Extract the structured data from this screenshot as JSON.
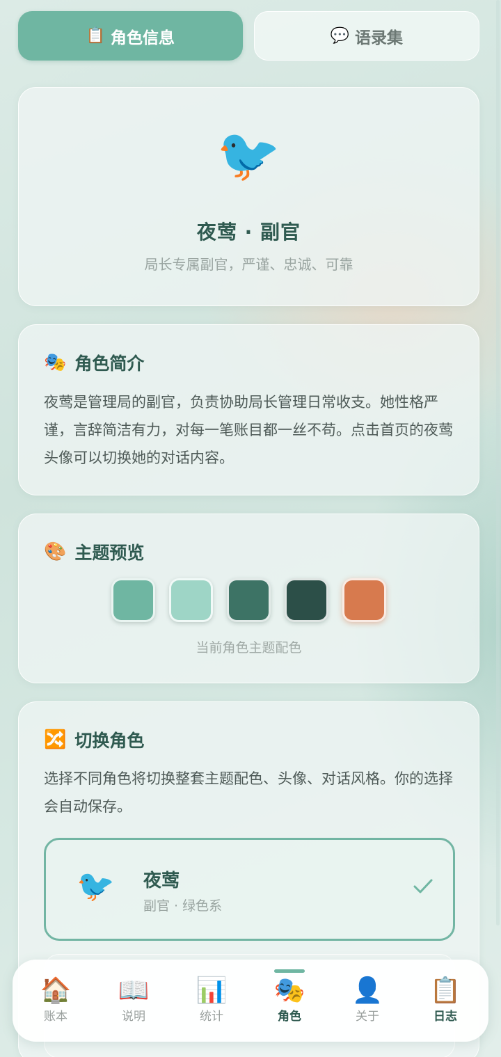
{
  "tabs": [
    {
      "label": "角色信息",
      "icon": "📋",
      "active": true
    },
    {
      "label": "语录集",
      "icon": "💬",
      "active": false
    }
  ],
  "profile": {
    "avatar": "🐦",
    "name": "夜莺 · 副官",
    "subtitle": "局长专属副官，严谨、忠诚、可靠"
  },
  "intro": {
    "icon": "🎭",
    "title": "角色简介",
    "text": "夜莺是管理局的副官，负责协助局长管理日常收支。她性格严谨，言辞简洁有力，对每一笔账目都一丝不苟。点击首页的夜莺头像可以切换她的对话内容。"
  },
  "theme": {
    "icon": "🎨",
    "title": "主题预览",
    "swatches": [
      "#6fb6a2",
      "#9ed5c6",
      "#3d7365",
      "#2c4f48",
      "#d77a4e"
    ],
    "caption": "当前角色主题配色"
  },
  "switch": {
    "icon": "🔀",
    "title": "切换角色",
    "text": "选择不同角色将切换整套主题配色、头像、对话风格。你的选择会自动保存。",
    "options": [
      {
        "avatar": "🐦",
        "name": "夜莺",
        "sub": "副官 · 绿色系",
        "selected": true
      }
    ]
  },
  "nav": [
    {
      "icon": "🏠",
      "label": "账本",
      "active": false
    },
    {
      "icon": "📖",
      "label": "说明",
      "active": false
    },
    {
      "icon": "📊",
      "label": "统计",
      "active": false
    },
    {
      "icon": "🎭",
      "label": "角色",
      "active": true
    },
    {
      "icon": "👤",
      "label": "关于",
      "active": false
    },
    {
      "icon": "📋",
      "label": "日志",
      "active": false
    }
  ]
}
